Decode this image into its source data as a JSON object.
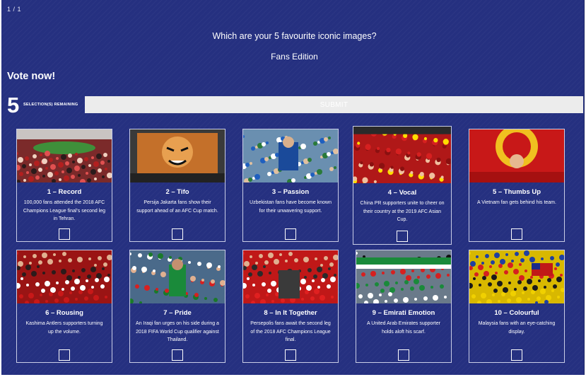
{
  "header": {
    "page_counter": "1 / 1",
    "question": "Which are your 5 favourite iconic images?",
    "edition": "Fans Edition",
    "cta": "Vote now!"
  },
  "selection": {
    "remaining_count": "5",
    "remaining_label": "Selection(s) remaining",
    "submit_label": "Submit"
  },
  "colors": {
    "background": "#253080",
    "submit_bg": "#ececec",
    "card_border": "#c9cde6"
  },
  "cards": [
    {
      "title": "1 – Record",
      "desc": "100,000 fans attended the 2018 AFC Champions League final's second leg in Tehran.",
      "icon": "stadium-crowd-photo"
    },
    {
      "title": "2 – Tifo",
      "desc": "Persija Jakarta fans show their support ahead of an AFC Cup match.",
      "icon": "tiger-tifo-photo"
    },
    {
      "title": "3 – Passion",
      "desc": "Uzbekistan fans have become known for their unwavering support.",
      "icon": "uzbek-fans-photo"
    },
    {
      "title": "4 – Vocal",
      "desc": "China PR supporters unite to cheer on their country at the 2019 AFC Asian Cup.",
      "icon": "china-fans-photo"
    },
    {
      "title": "5 – Thumbs Up",
      "desc": "A Vietnam fan gets behind his team.",
      "icon": "vietnam-fan-photo"
    },
    {
      "title": "6 – Rousing",
      "desc": "Kashima Antlers supporters turning up the volume.",
      "icon": "kashima-fans-photo"
    },
    {
      "title": "7 – Pride",
      "desc": "An Iraqi fan urges on his side during a 2018 FIFA World Cup qualifier against Thailand.",
      "icon": "iraqi-fan-photo"
    },
    {
      "title": "8 – In It Together",
      "desc": "Persepolis fans await the second leg of the 2018 AFC Champions League final.",
      "icon": "persepolis-fans-photo"
    },
    {
      "title": "9 – Emirati Emotion",
      "desc": "A United Arab Emirates supporter holds aloft his scarf.",
      "icon": "emirati-fan-photo"
    },
    {
      "title": "10 – Colourful",
      "desc": "Malaysia fans with an eye-catching display.",
      "icon": "malaysia-fans-photo"
    }
  ]
}
